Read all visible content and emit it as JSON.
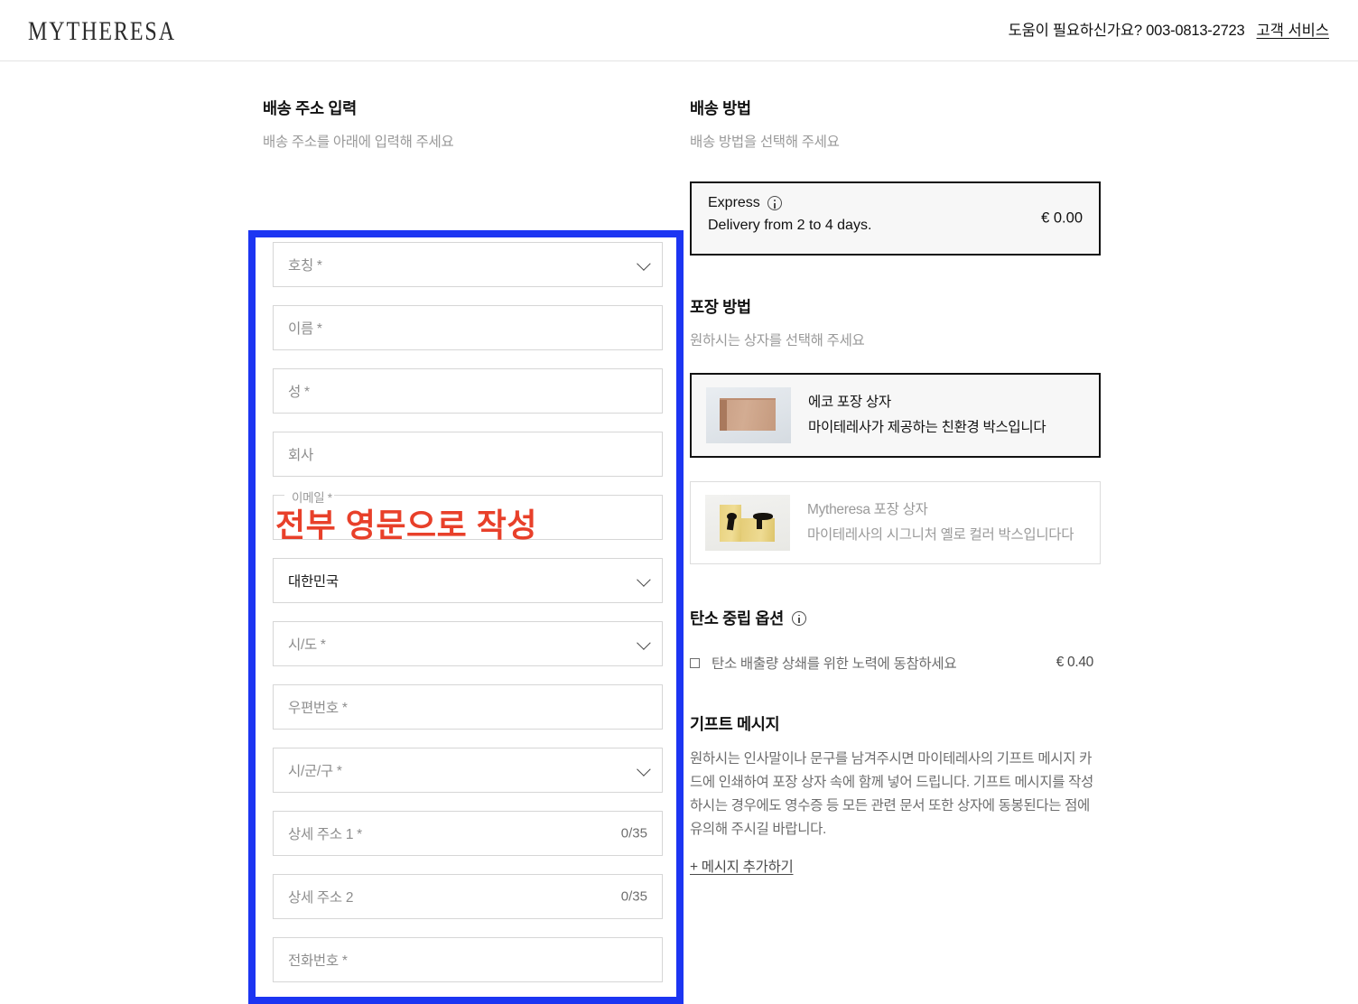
{
  "header": {
    "logo": "MYTHERESA",
    "help_text": "도움이 필요하신가요? 003-0813-2723",
    "customer_service": "고객 서비스"
  },
  "shipping_address": {
    "title": "배송 주소 입력",
    "subtitle": "배송 주소를 아래에 입력해 주세요",
    "fields": [
      {
        "label": "호칭 *",
        "type": "select",
        "value": ""
      },
      {
        "label": "이름 *",
        "type": "text",
        "value": ""
      },
      {
        "label": "성 *",
        "type": "text",
        "value": ""
      },
      {
        "label": "회사",
        "type": "text",
        "value": ""
      },
      {
        "label": "이메일 *",
        "type": "notched",
        "value": ""
      },
      {
        "label": "대한민국",
        "type": "select",
        "value": "대한민국"
      },
      {
        "label": "시/도 *",
        "type": "select",
        "value": ""
      },
      {
        "label": "우편번호 *",
        "type": "text",
        "value": ""
      },
      {
        "label": "시/군/구 *",
        "type": "select",
        "value": ""
      },
      {
        "label": "상세 주소 1 *",
        "type": "text",
        "value": "",
        "counter": "0/35"
      },
      {
        "label": "상세 주소 2",
        "type": "text",
        "value": "",
        "counter": "0/35"
      },
      {
        "label": "전화번호 *",
        "type": "text",
        "value": ""
      }
    ],
    "annotation": "전부 영문으로 작성",
    "annotation_color": "#e8402a",
    "highlight_color": "#1c35f2"
  },
  "shipping_method": {
    "title": "배송 방법",
    "subtitle": "배송 방법을 선택해 주세요",
    "option": {
      "name": "Express",
      "delivery": "Delivery from 2 to 4 days.",
      "price": "€ 0.00",
      "selected": true
    }
  },
  "packaging": {
    "title": "포장 방법",
    "subtitle": "원하시는 상자를 선택해 주세요",
    "options": [
      {
        "name": "에코 포장 상자",
        "desc": "마이테레사가 제공하는 친환경 박스입니다",
        "selected": true
      },
      {
        "name": "Mytheresa 포장 상자",
        "desc": "마이테레사의 시그니처 옐로 컬러 박스입니다다",
        "selected": false
      }
    ]
  },
  "carbon": {
    "title": "탄소 중립 옵션",
    "option_label": "탄소 배출량 상쇄를 위한 노력에 동참하세요",
    "price": "€ 0.40",
    "checked": false
  },
  "gift_message": {
    "title": "기프트 메시지",
    "description": "원하시는 인사말이나 문구를 남겨주시면 마이테레사의 기프트 메시지 카드에 인쇄하여 포장 상자 속에 함께 넣어 드립니다. 기프트 메시지를 작성하시는 경우에도 영수증 등 모든 관련 문서 또한 상자에 동봉된다는 점에 유의해 주시길 바랍니다.",
    "add_link": "+ 메시지 추가하기"
  }
}
